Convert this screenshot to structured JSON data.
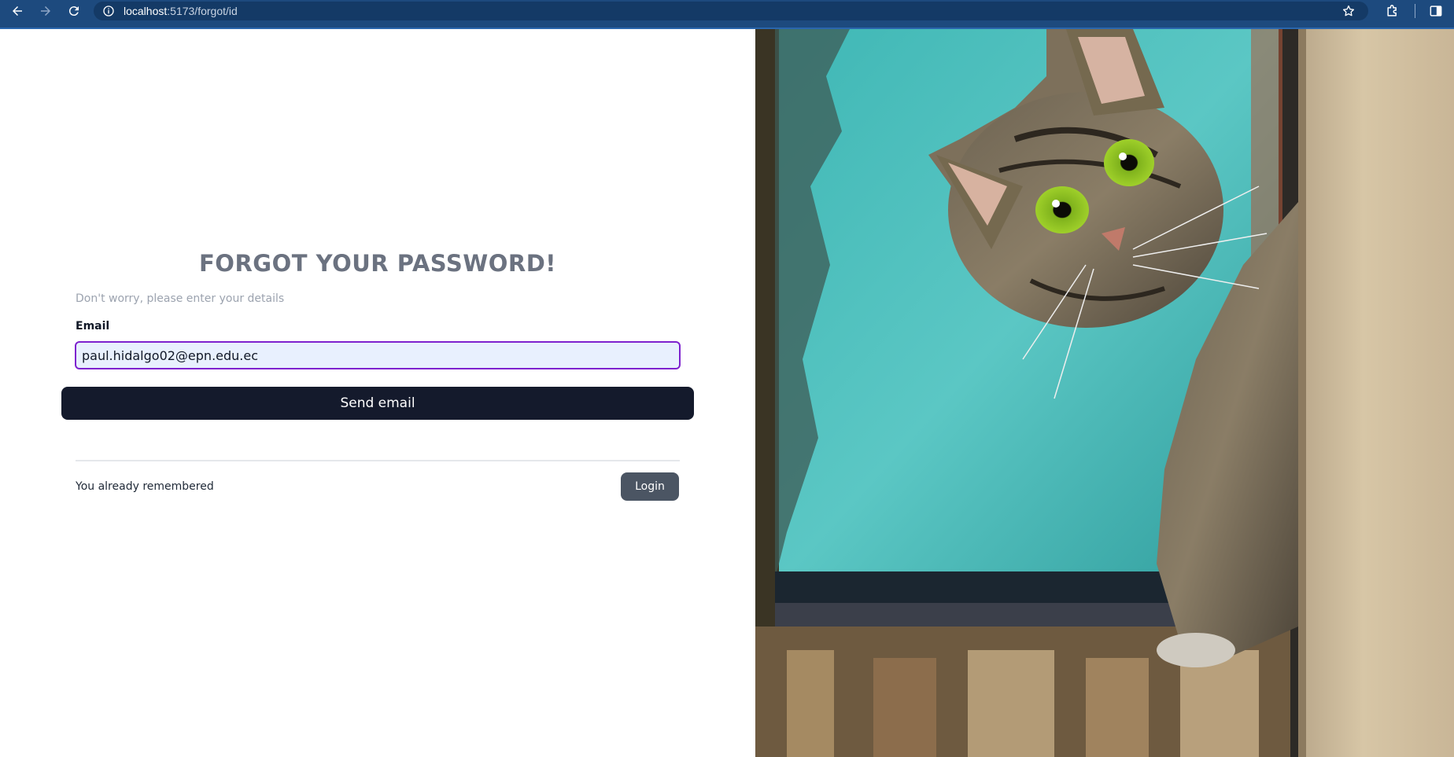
{
  "browser": {
    "url_host": "localhost",
    "url_rest": ":5173/forgot/id"
  },
  "form": {
    "title": "FORGOT YOUR PASSWORD!",
    "subtitle": "Don't worry, please enter your details",
    "email_label": "Email",
    "email_value": "paul.hidalgo02@epn.edu.ec",
    "send_label": "Send email",
    "remember_text": "You already remembered",
    "login_label": "Login"
  },
  "colors": {
    "browser_bar": "#1d4a7e",
    "title": "#6b7280",
    "input_border": "#7e22ce",
    "input_bg": "#e8f0fe",
    "send_bg": "#141a2c",
    "login_bg": "#4b5563"
  },
  "icons": {
    "back": "arrow-left-icon",
    "forward": "arrow-right-icon",
    "reload": "reload-icon",
    "site_info": "info-icon",
    "bookmark": "star-icon",
    "extensions": "puzzle-icon",
    "side_panel": "side-panel-icon"
  },
  "image": {
    "subject": "tabby cat with green eyes peeking around a wall"
  }
}
